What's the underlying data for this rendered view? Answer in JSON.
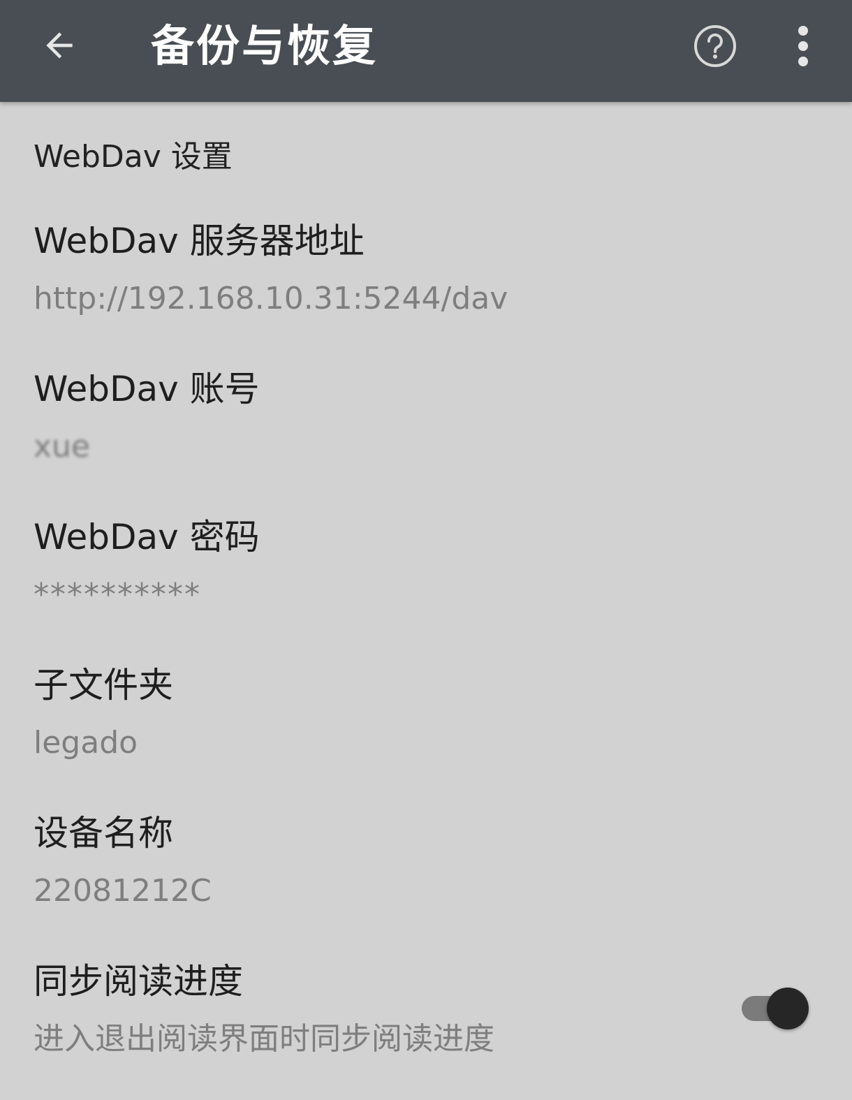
{
  "toolbar": {
    "title": "备份与恢复",
    "back_icon": "arrow-left-icon",
    "help_icon": "help-circle-icon",
    "more_icon": "more-vertical-icon",
    "background": "#484e53"
  },
  "section": {
    "title": "WebDav 设置"
  },
  "prefs": {
    "server_url": {
      "title": "WebDav 服务器地址",
      "summary": "http://192.168.10.31:5244/dav"
    },
    "account": {
      "title": "WebDav 账号",
      "summary": "xue"
    },
    "password": {
      "title": "WebDav 密码",
      "summary": "**********"
    },
    "subfolder": {
      "title": "子文件夹",
      "summary": "legado"
    },
    "device_name": {
      "title": "设备名称",
      "summary": "22081212C"
    },
    "sync_progress": {
      "title": "同步阅读进度",
      "summary": "进入退出阅读界面时同步阅读进度",
      "enabled": true
    }
  }
}
